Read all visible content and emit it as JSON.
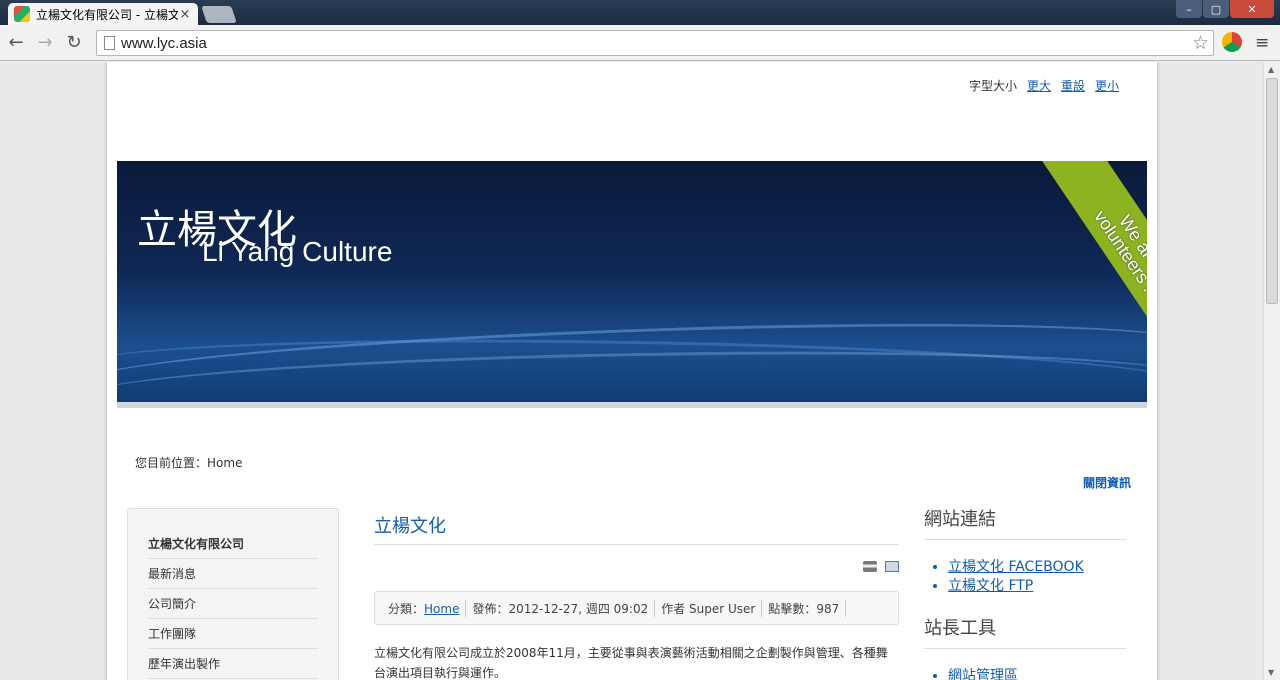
{
  "browser": {
    "tab_title": "立楊文化有限公司 - 立楊文",
    "tab_close": "×",
    "url": "www.lyc.asia",
    "back_glyph": "←",
    "forward_glyph": "→",
    "reload_glyph": "↻",
    "star_glyph": "☆",
    "menu_glyph": "≡",
    "win_min": "–",
    "win_max": "▢",
    "win_close": "✕"
  },
  "fontsize": {
    "label": "字型大小",
    "bigger": "更大",
    "reset": "重設",
    "smaller": "更小"
  },
  "banner": {
    "title_zh": "立楊文化",
    "title_en": "Li Yang Culture",
    "ribbon": "We are\nvolunteers !",
    "ribbon_color": "#8db321"
  },
  "breadcrumb": {
    "prefix": "您目前位置：",
    "current": "Home"
  },
  "close_info": "關閉資訊",
  "left_menu": [
    {
      "label": "立楊文化有限公司"
    },
    {
      "label": "最新消息"
    },
    {
      "label": "公司簡介"
    },
    {
      "label": "工作團隊"
    },
    {
      "label": "歷年演出製作"
    }
  ],
  "article": {
    "title": "立楊文化",
    "meta": {
      "category_label": "分類：",
      "category_link": "Home",
      "published": "發佈：2012-12-27, 週四 09:02",
      "author": "作者 Super User",
      "hits": "點擊數：987"
    },
    "body": "立楊文化有限公司成立於2008年11月，主要從事與表演藝術活動相關之企劃製作與管理、各種舞台演出項目執行與運作。"
  },
  "sidebar": {
    "links_title": "網站連結",
    "links": [
      {
        "label": "立楊文化 FACEBOOK"
      },
      {
        "label": "立楊文化 FTP"
      }
    ],
    "tools_title": "站長工具",
    "tools": [
      {
        "label": "網站管理區"
      }
    ]
  },
  "colors": {
    "link": "#135cae",
    "banner_dark": "#0b1a3a"
  }
}
